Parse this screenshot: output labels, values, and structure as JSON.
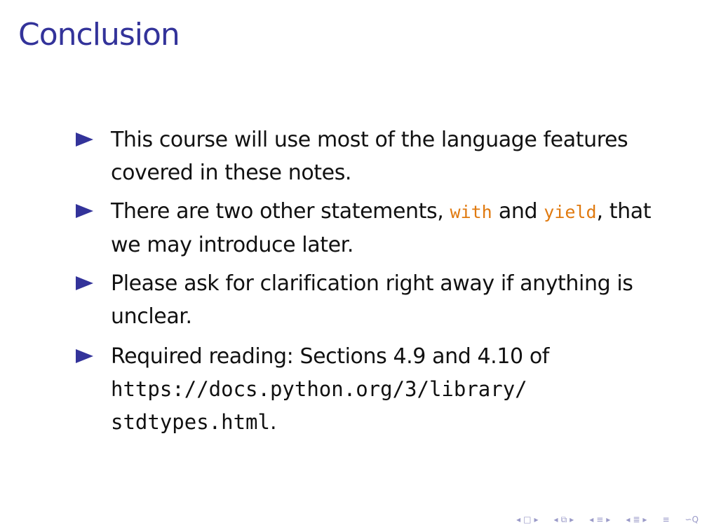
{
  "title": "Conclusion",
  "bullets": {
    "b1": "This course will use most of the language features covered in these notes.",
    "b2": {
      "before": "There are two other statements, ",
      "code1": "with",
      "middle": " and ",
      "code2": "yield",
      "after": ", that we may introduce later."
    },
    "b3": "Please ask for clarification right away if anything is unclear.",
    "b4": {
      "text": "Required reading: Sections 4.9 and 4.10 of ",
      "url_line1": "https://docs.python.org/3/library/",
      "url_line2": "stdtypes.html",
      "end": "."
    }
  },
  "colors": {
    "title": "#33339a",
    "bullet": "#33339a",
    "code": "#e07a10",
    "nav": "#9a9ac8"
  },
  "nav_icons": [
    "nav-prev-frame-icon",
    "nav-frame-icon",
    "nav-next-frame-icon",
    "nav-prev-subsection-icon",
    "nav-subsection-icon",
    "nav-next-subsection-icon",
    "nav-prev-section-icon",
    "nav-section-icon",
    "nav-next-section-icon",
    "nav-align-icon",
    "nav-search-icon"
  ]
}
